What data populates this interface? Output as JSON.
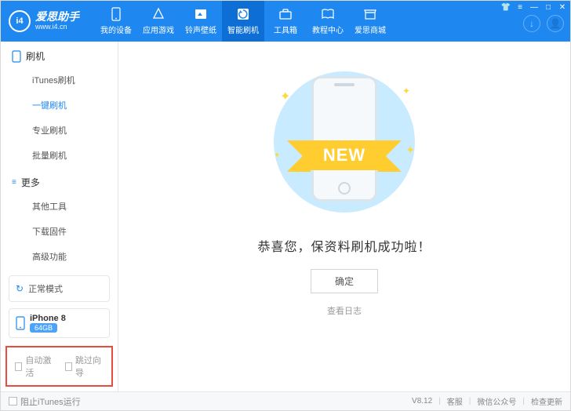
{
  "brand": {
    "name": "爱思助手",
    "url": "www.i4.cn",
    "logo": "i4"
  },
  "nav": [
    {
      "label": "我的设备"
    },
    {
      "label": "应用游戏"
    },
    {
      "label": "铃声壁纸"
    },
    {
      "label": "智能刷机",
      "active": true
    },
    {
      "label": "工具箱"
    },
    {
      "label": "教程中心"
    },
    {
      "label": "爱思商城"
    }
  ],
  "sidebar": {
    "section1": {
      "title": "刷机",
      "items": [
        "iTunes刷机",
        "一键刷机",
        "专业刷机",
        "批量刷机"
      ],
      "activeIndex": 1
    },
    "section2": {
      "title": "更多",
      "items": [
        "其他工具",
        "下载固件",
        "高级功能"
      ]
    },
    "mode": "正常模式",
    "device": {
      "name": "iPhone 8",
      "storage": "64GB"
    },
    "checks": {
      "autoActivate": "自动激活",
      "skipGuide": "跳过向导"
    }
  },
  "main": {
    "ribbon": "NEW",
    "successText": "恭喜您，保资料刷机成功啦！",
    "okBtn": "确定",
    "logLink": "查看日志"
  },
  "footer": {
    "blockItunes": "阻止iTunes运行",
    "version": "V8.12",
    "support": "客服",
    "wechat": "微信公众号",
    "update": "检查更新"
  }
}
